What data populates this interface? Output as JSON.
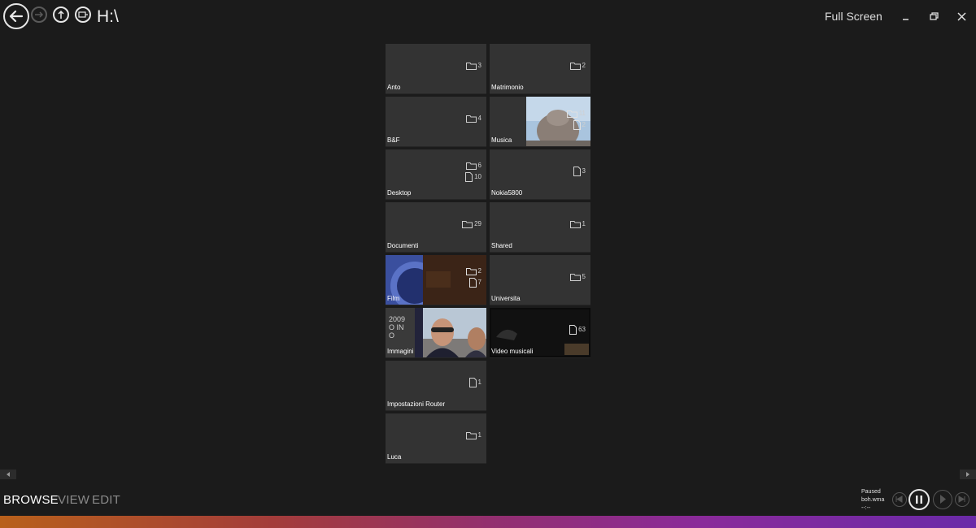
{
  "header": {
    "path": "H:\\",
    "fullscreen_label": "Full Screen"
  },
  "tiles": [
    {
      "name": "Anto",
      "folders": "3",
      "files": ""
    },
    {
      "name": "Matrimonio",
      "folders": "2",
      "files": ""
    },
    {
      "name": "B&F",
      "folders": "4",
      "files": ""
    },
    {
      "name": "Musica",
      "folders": "11",
      "files": "2"
    },
    {
      "name": "Desktop",
      "folders": "6",
      "files": "10"
    },
    {
      "name": "Nokia5800",
      "folders": "",
      "files": "3"
    },
    {
      "name": "Documenti",
      "folders": "29",
      "files": ""
    },
    {
      "name": "Shared",
      "folders": "1",
      "files": ""
    },
    {
      "name": "Film",
      "folders": "2",
      "files": "7"
    },
    {
      "name": "Universita",
      "folders": "5",
      "files": ""
    },
    {
      "name": "Immagini",
      "folders": "",
      "files": "",
      "thumb_text": "2009\nO IN\nO"
    },
    {
      "name": "Video musicali",
      "folders": "",
      "files": "63"
    },
    {
      "name": "Impostazioni Router",
      "folders": "",
      "files": "1"
    },
    {
      "name": "Luca",
      "folders": "1",
      "files": ""
    }
  ],
  "nav": {
    "browse": "BROWSE",
    "view": "VIEW",
    "edit": "EDIT"
  },
  "player": {
    "status": "Paused",
    "track": "boh.wma",
    "time": "--:--"
  },
  "colors": {
    "background": "#1b1b1b",
    "tile": "#333333",
    "active_tab": "#ffffff",
    "inactive_tab": "#8a8a8a"
  }
}
